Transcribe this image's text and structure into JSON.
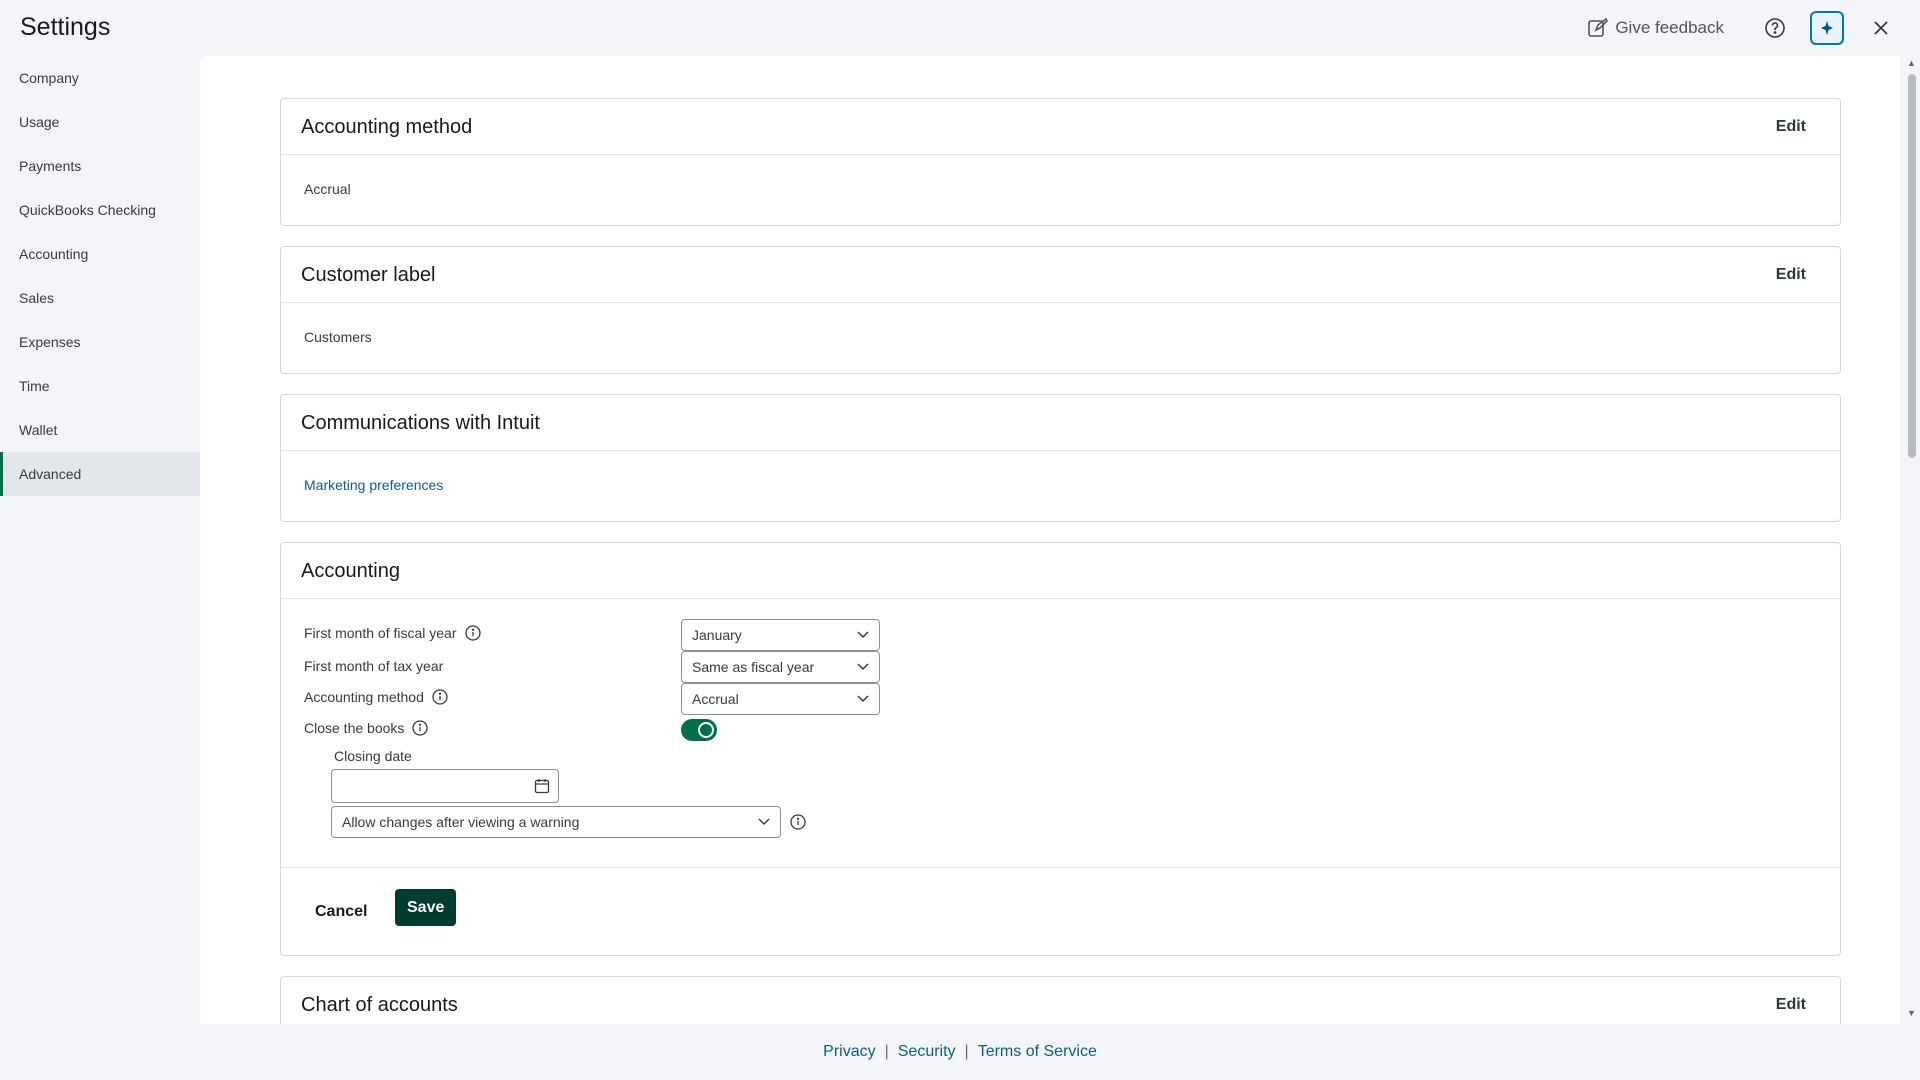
{
  "app": {
    "title": "Settings"
  },
  "topbar": {
    "feedback_label": "Give feedback"
  },
  "sidebar": {
    "items": [
      {
        "label": "Company"
      },
      {
        "label": "Usage"
      },
      {
        "label": "Payments"
      },
      {
        "label": "QuickBooks Checking"
      },
      {
        "label": "Accounting"
      },
      {
        "label": "Sales"
      },
      {
        "label": "Expenses"
      },
      {
        "label": "Time"
      },
      {
        "label": "Wallet"
      },
      {
        "label": "Advanced",
        "active": true
      }
    ]
  },
  "cards": {
    "accounting_method": {
      "title": "Accounting method",
      "edit": "Edit",
      "value": "Accrual"
    },
    "customer_label": {
      "title": "Customer label",
      "edit": "Edit",
      "value": "Customers"
    },
    "communications": {
      "title": "Communications with Intuit",
      "link": "Marketing preferences"
    },
    "accounting": {
      "title": "Accounting",
      "fiscal_year_label": "First month of fiscal year",
      "fiscal_year_value": "January",
      "tax_year_label": "First month of tax year",
      "tax_year_value": "Same as fiscal year",
      "method_label": "Accounting method",
      "method_value": "Accrual",
      "close_books_label": "Close the books",
      "close_books_on": true,
      "closing_date_label": "Closing date",
      "closing_date_value": "",
      "changes_value": "Allow changes after viewing a warning",
      "cancel": "Cancel",
      "save": "Save"
    },
    "chart_of_accounts": {
      "title": "Chart of accounts",
      "edit": "Edit"
    }
  },
  "footer": {
    "privacy": "Privacy",
    "security": "Security",
    "terms": "Terms of Service",
    "separator": "|"
  },
  "colors": {
    "accent": "#00704a",
    "save_bg": "#003b2f",
    "link": "#0b5f8a"
  }
}
